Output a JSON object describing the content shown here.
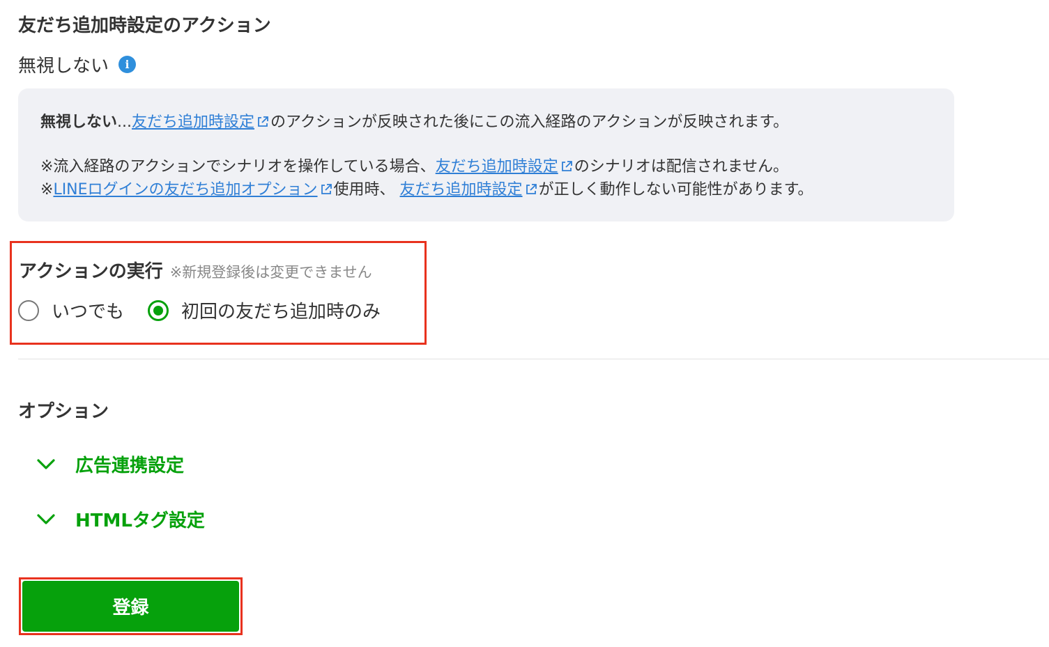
{
  "friend_add_action": {
    "title": "友だち追加時設定のアクション",
    "value": "無視しない",
    "info_icon": "info-icon"
  },
  "note": {
    "line1_strong": "無視しない",
    "line1_dots": "...",
    "line1_link": "友だち追加時設定",
    "line1_rest": "のアクションが反映された後にこの流入経路のアクションが反映されます。",
    "line2_prefix": "※流入経路のアクションでシナリオを操作している場合、",
    "line2_link": "友だち追加時設定",
    "line2_rest": "のシナリオは配信されません。",
    "line3_prefix": "※",
    "line3_link1": "LINEログインの友だち追加オプション",
    "line3_mid": "使用時、 ",
    "line3_link2": "友だち追加時設定",
    "line3_rest": "が正しく動作しない可能性があります。"
  },
  "action_execution": {
    "title": "アクションの実行",
    "hint": "※新規登録後は変更できません",
    "options": [
      {
        "label": "いつでも",
        "checked": false
      },
      {
        "label": "初回の友だち追加時のみ",
        "checked": true
      }
    ]
  },
  "options_section": {
    "title": "オプション",
    "accordions": [
      {
        "label": "広告連携設定",
        "icon": "chevron-down-icon"
      },
      {
        "label": "HTMLタグ設定",
        "icon": "chevron-down-icon"
      }
    ]
  },
  "submit": {
    "label": "登録"
  },
  "colors": {
    "green": "#06a10c",
    "link": "#2f7fd6",
    "highlight": "#e8321e",
    "note_bg": "#f0f1f5"
  }
}
